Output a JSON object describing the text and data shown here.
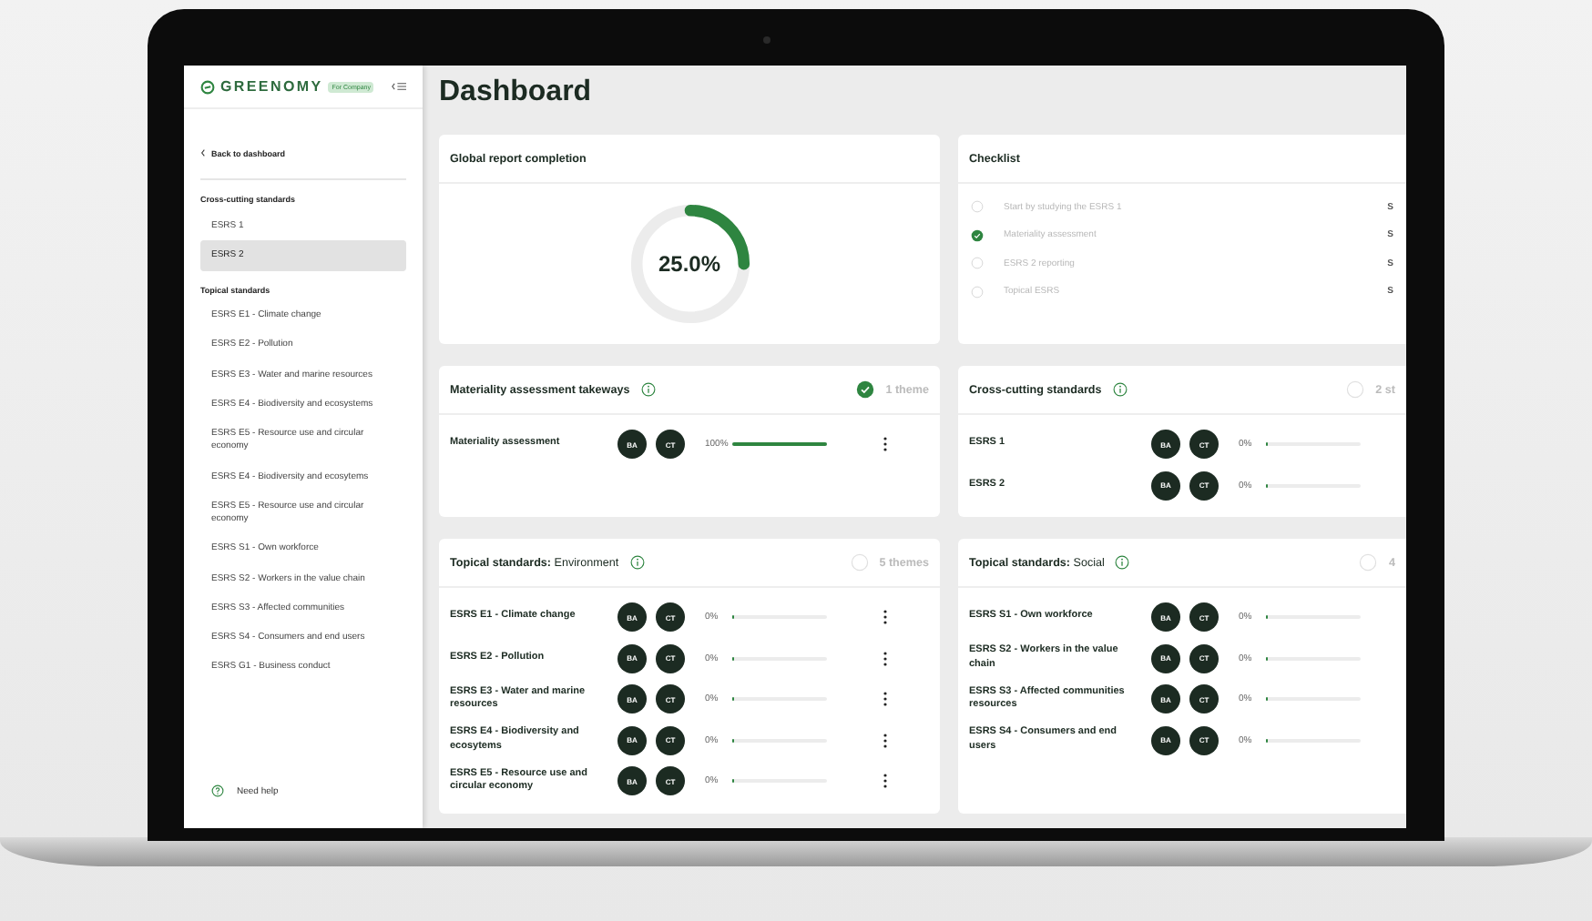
{
  "sidebar": {
    "brand": "GREENOMY",
    "brand_badge": "For Company",
    "back_link": "Back to dashboard",
    "sections": [
      {
        "title": "Cross-cutting standards",
        "items": [
          {
            "label": "ESRS 1",
            "selected": false
          },
          {
            "label": "ESRS 2",
            "selected": true
          }
        ]
      },
      {
        "title": "Topical standards",
        "items": [
          {
            "label": "ESRS E1 - Climate change",
            "selected": false
          },
          {
            "label": "ESRS E2 - Pollution",
            "selected": false
          },
          {
            "label": "ESRS E3 - Water and marine resources",
            "selected": false
          },
          {
            "label": "ESRS E4 - Biodiversity and ecosystems",
            "selected": false
          },
          {
            "label": "ESRS E5 - Resource use and circular economy",
            "selected": false
          },
          {
            "label": "ESRS E4 - Biodiversity and ecosytems",
            "selected": false
          },
          {
            "label": "ESRS E5 - Resource use and circular economy",
            "selected": false
          },
          {
            "label": "ESRS S1 - Own workforce",
            "selected": false
          },
          {
            "label": "ESRS S2 - Workers in the value chain",
            "selected": false
          },
          {
            "label": "ESRS S3 - Affected communities",
            "selected": false
          },
          {
            "label": "ESRS S4 - Consumers and end users",
            "selected": false
          },
          {
            "label": "ESRS G1 - Business conduct",
            "selected": false
          }
        ]
      }
    ],
    "help": "Need help"
  },
  "title": "Dashboard",
  "global_report": {
    "title": "Global report completion",
    "value": "25.0%",
    "level": 0.25
  },
  "checklist": {
    "title": "Checklist",
    "items": [
      {
        "label": "Start by studying the ESRS 1",
        "checked": false,
        "column_2": "S"
      },
      {
        "label": "Materiality assessment",
        "checked": true,
        "column_2": "S"
      },
      {
        "label": "ESRS 2 reporting",
        "checked": false,
        "column_2": "S"
      },
      {
        "label": "Topical ESRS",
        "checked": false,
        "column_2": "S"
      }
    ]
  },
  "cards": [
    {
      "title": "Materiality assessment takeways",
      "status": {
        "complete": true,
        "text": "1 theme"
      },
      "rows": [
        {
          "name": "Materiality assessment",
          "avatars": [
            "BA",
            "CT"
          ],
          "percent": "100%",
          "level": 1,
          "menu": true
        }
      ]
    },
    {
      "title": "Cross-cutting standards",
      "status": {
        "complete": false,
        "text": "2 st"
      },
      "rows": [
        {
          "name": "ESRS 1",
          "avatars": [
            "BA",
            "CT"
          ],
          "percent": "0%",
          "level": 0,
          "menu": false
        },
        {
          "name": "ESRS 2",
          "avatars": [
            "BA",
            "CT"
          ],
          "percent": "0%",
          "level": 0,
          "menu": false
        }
      ]
    },
    {
      "title": "**Topical standards:** Environment",
      "status": {
        "complete": false,
        "text": "5 themes"
      },
      "rows": [
        {
          "name": "ESRS E1 - Climate change",
          "avatars": [
            "BA",
            "CT"
          ],
          "percent": "0%",
          "level": 0,
          "menu": true
        },
        {
          "name": "ESRS E2 - Pollution",
          "avatars": [
            "BA",
            "CT"
          ],
          "percent": "0%",
          "level": 0,
          "menu": true
        },
        {
          "name": "ESRS E3 - Water and marine resources",
          "avatars": [
            "BA",
            "CT"
          ],
          "percent": "0%",
          "level": 0,
          "menu": true
        },
        {
          "name": "ESRS E4 - Biodiversity and ecosytems",
          "avatars": [
            "BA",
            "CT"
          ],
          "percent": "0%",
          "level": 0,
          "menu": true
        },
        {
          "name": "ESRS E5 - Resource use and circular economy",
          "avatars": [
            "BA",
            "CT"
          ],
          "percent": "0%",
          "level": 0,
          "menu": true
        }
      ]
    },
    {
      "title": "**Topical standards:** Social",
      "status": {
        "complete": false,
        "text": "4"
      },
      "rows": [
        {
          "name": "ESRS S1 - Own workforce",
          "avatars": [
            "BA",
            "CT"
          ],
          "percent": "0%",
          "level": 0,
          "menu": false
        },
        {
          "name": "ESRS S2 - Workers in the value chain",
          "avatars": [
            "BA",
            "CT"
          ],
          "percent": "0%",
          "level": 0,
          "menu": false
        },
        {
          "name": "ESRS S3 - Affected communities resources",
          "avatars": [
            "BA",
            "CT"
          ],
          "percent": "0%",
          "level": 0,
          "menu": false
        },
        {
          "name": "ESRS S4 - Consumers and end users",
          "avatars": [
            "BA",
            "CT"
          ],
          "percent": "0%",
          "level": 0,
          "menu": false
        }
      ]
    }
  ]
}
